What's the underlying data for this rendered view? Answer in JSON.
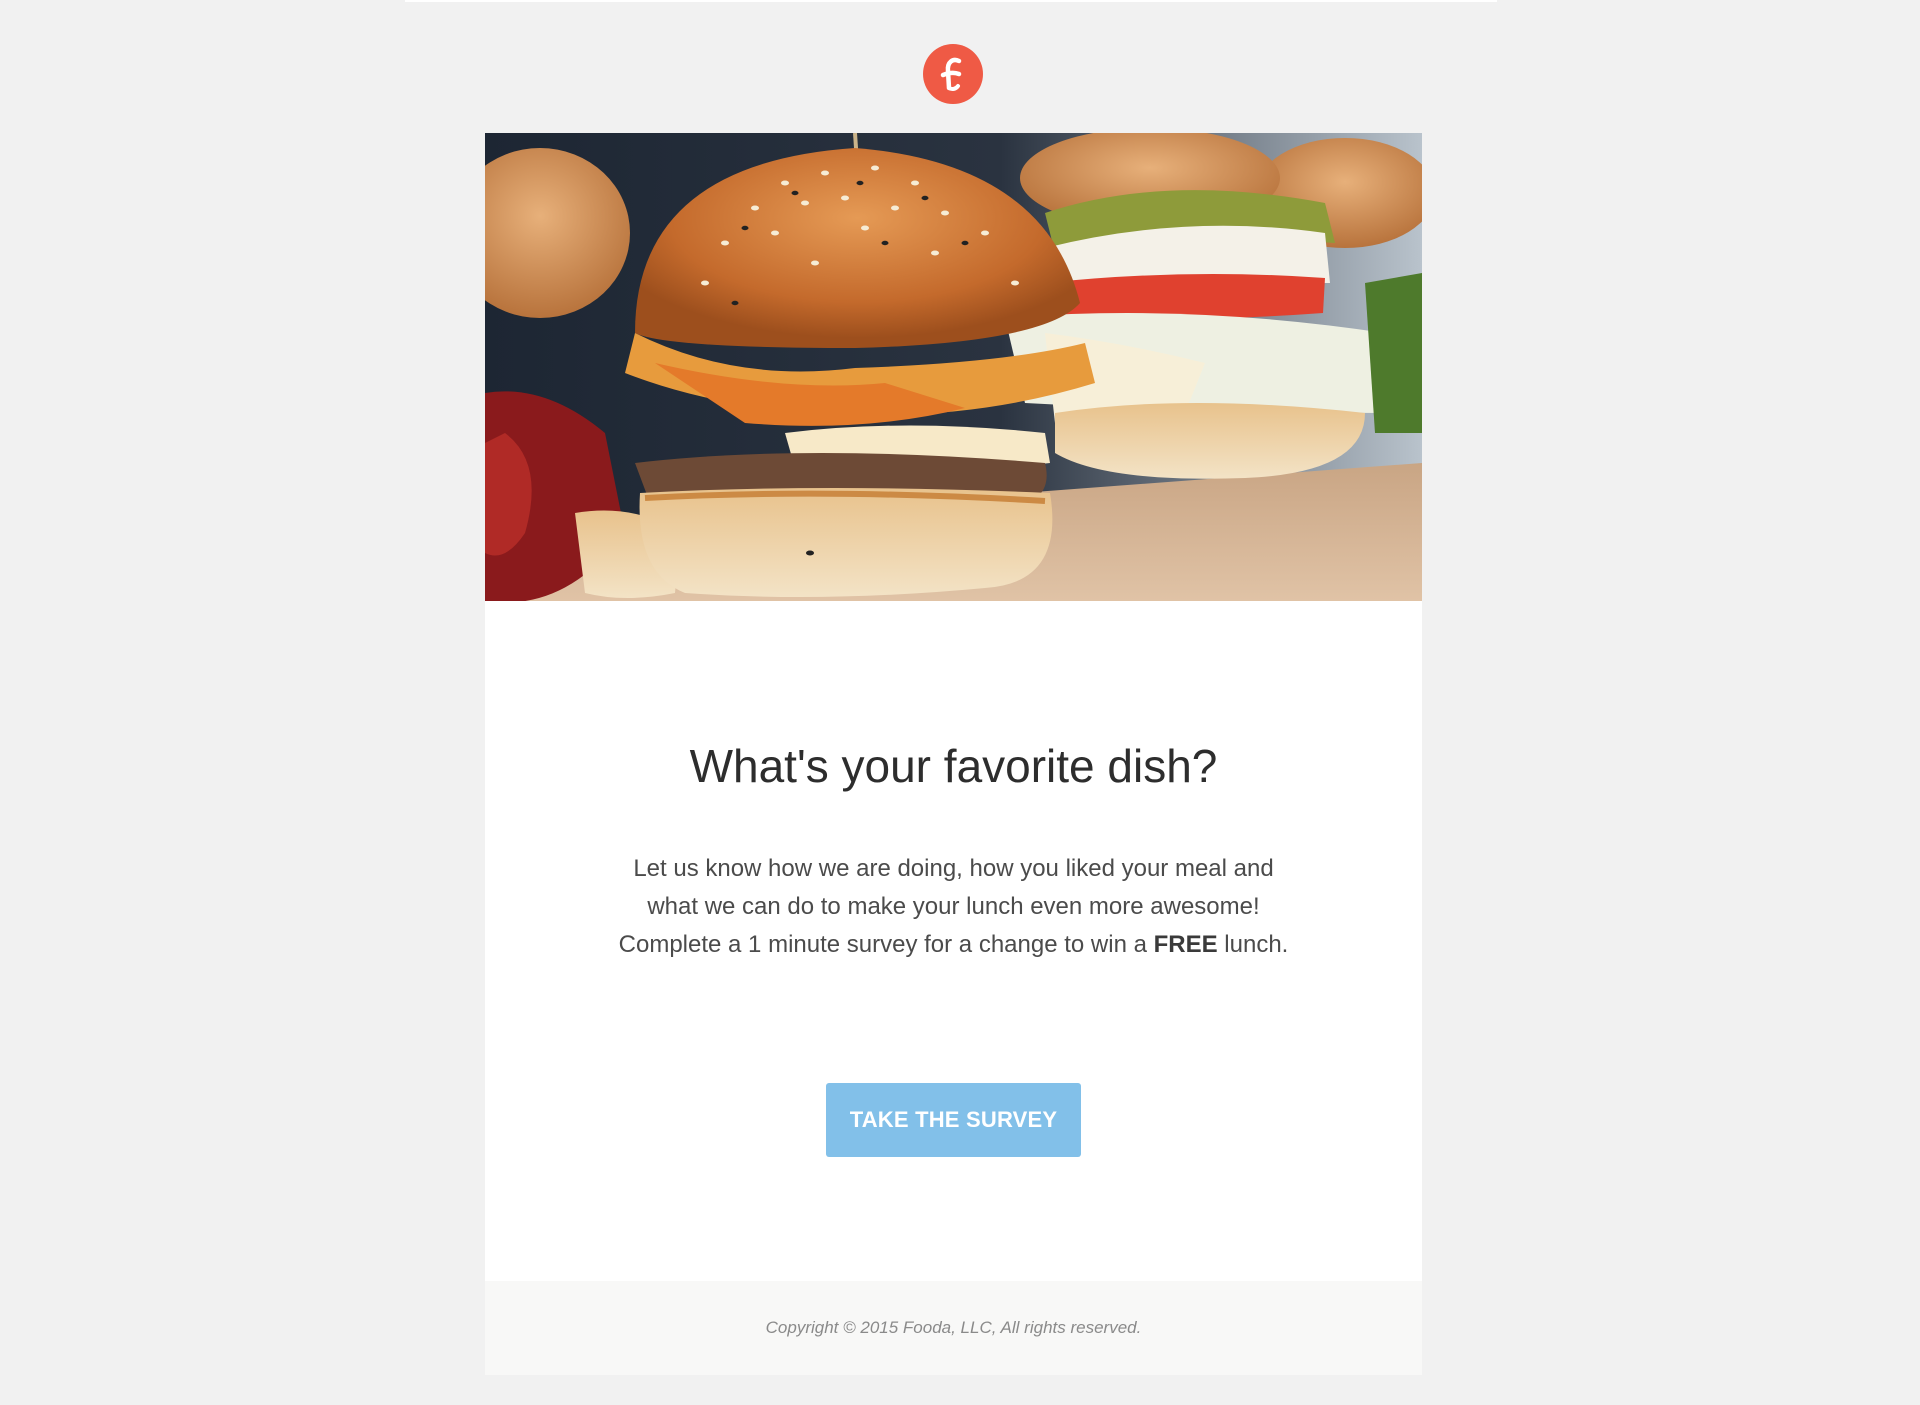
{
  "email": {
    "brand": {
      "logo_icon": "fooda-f-logo-icon",
      "logo_color": "#ef5a45"
    },
    "hero": {
      "image_alt": "Burgers"
    },
    "headline": "What's your favorite dish?",
    "body": {
      "line1": "Let us know how we are doing, how you liked your meal and",
      "line2": "what we can do to make your lunch even more awesome!",
      "line3_prefix": "Complete a 1 minute survey for a change to win a ",
      "line3_bold": "FREE",
      "line3_suffix": " lunch."
    },
    "cta": {
      "label": "TAKE THE SURVEY",
      "color": "#82c0e9"
    },
    "footer": {
      "copyright": "Copyright © 2015 Fooda, LLC, All rights reserved."
    },
    "colors": {
      "page_background": "#f1f1f1",
      "card_background": "#ffffff",
      "footer_background": "#f8f8f7"
    }
  }
}
